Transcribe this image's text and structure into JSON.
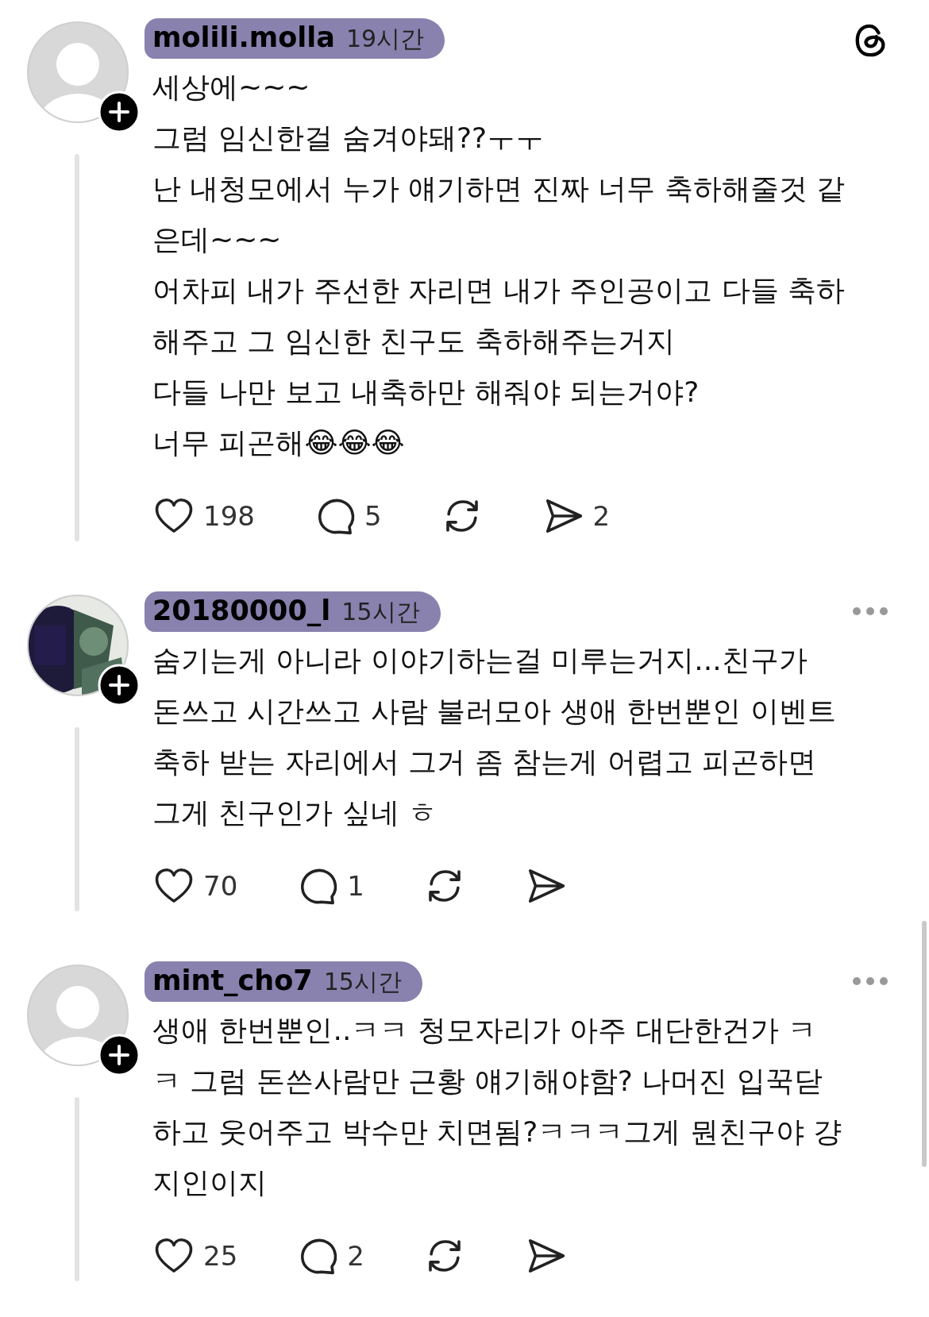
{
  "comments": [
    {
      "username": "molili.molla",
      "time": "19시간",
      "avatar": {
        "kind": "default"
      },
      "more": false,
      "lines": [
        "세상에~~~",
        "그럼 임신한걸 숨겨야돼??ㅜㅜ",
        "난 내청모에서 누가 얘기하면 진짜 너무 축하해줄것 같",
        "은데~~~",
        "어차피 내가 주선한 자리면 내가 주인공이고 다들 축하",
        "해주고 그 임신한 친구도 축하해주는거지",
        "다들 나만 보고 내축하만 해줘야 되는거야?",
        "너무 피곤해😂😂😂"
      ],
      "actions": [
        {
          "kind": "like",
          "count": "198"
        },
        {
          "kind": "reply",
          "count": "5"
        },
        {
          "kind": "repost"
        },
        {
          "kind": "share",
          "count": "2"
        }
      ]
    },
    {
      "username": "20180000_l",
      "time": "15시간",
      "more": true,
      "lines": [
        "숨기는게 아니라 이야기하는걸 미루는거지...친구가",
        "돈쓰고 시간쓰고 사람 불러모아 생애 한번뿐인 이벤트",
        "축하 받는 자리에서 그거 좀 참는게 어렵고 피곤하면",
        "그게 친구인가 싶네 ㅎ"
      ],
      "actions": [
        {
          "kind": "like",
          "count": "70"
        },
        {
          "kind": "reply",
          "count": "1"
        },
        {
          "kind": "repost"
        },
        {
          "kind": "share"
        }
      ]
    },
    {
      "username": "mint_cho7",
      "time": "15시간",
      "avatar": {
        "kind": "default"
      },
      "more": true,
      "lines": [
        "생애 한번뿐인..ㅋㅋ  청모자리가 아주 대단한건가 ㅋ",
        "ㅋ 그럼 돈쓴사람만 근황 얘기해야함? 나머진 입꾹닫",
        "하고 웃어주고 박수만 치면됨?ㅋㅋㅋ그게 뭔친구야 걍",
        "지인이지"
      ],
      "actions": [
        {
          "kind": "like",
          "count": "25"
        },
        {
          "kind": "reply",
          "count": "2"
        },
        {
          "kind": "repost"
        },
        {
          "kind": "share"
        }
      ]
    }
  ]
}
